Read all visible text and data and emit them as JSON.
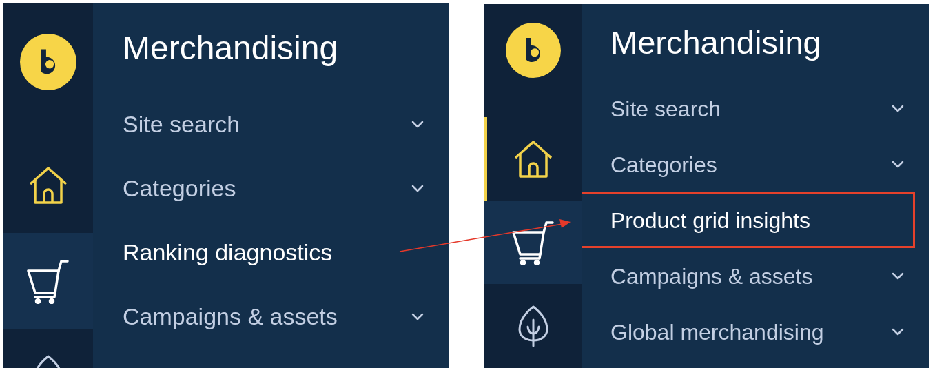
{
  "panels": [
    {
      "rail": [
        {
          "kind": "home",
          "selected": false,
          "indicator": false
        },
        {
          "kind": "cart",
          "selected": true,
          "indicator": false
        },
        {
          "kind": "leaf",
          "selected": false,
          "indicator": false
        }
      ],
      "title": "Merchandising",
      "items": [
        {
          "label": "Site search",
          "expandable": true,
          "selected": false,
          "highlighted": false
        },
        {
          "label": "Categories",
          "expandable": true,
          "selected": false,
          "highlighted": false
        },
        {
          "label": "Ranking diagnostics",
          "expandable": false,
          "selected": true,
          "highlighted": false
        },
        {
          "label": "Campaigns & assets",
          "expandable": true,
          "selected": false,
          "highlighted": false
        }
      ]
    },
    {
      "rail": [
        {
          "kind": "home",
          "selected": false,
          "indicator": true
        },
        {
          "kind": "cart",
          "selected": true,
          "indicator": false
        },
        {
          "kind": "leaf",
          "selected": false,
          "indicator": false
        }
      ],
      "title": "Merchandising",
      "items": [
        {
          "label": "Site search",
          "expandable": true,
          "selected": false,
          "highlighted": false
        },
        {
          "label": "Categories",
          "expandable": true,
          "selected": false,
          "highlighted": false
        },
        {
          "label": "Product grid insights",
          "expandable": false,
          "selected": true,
          "highlighted": true
        },
        {
          "label": "Campaigns & assets",
          "expandable": true,
          "selected": false,
          "highlighted": false
        },
        {
          "label": "Global merchandising",
          "expandable": true,
          "selected": false,
          "highlighted": false
        }
      ]
    }
  ]
}
